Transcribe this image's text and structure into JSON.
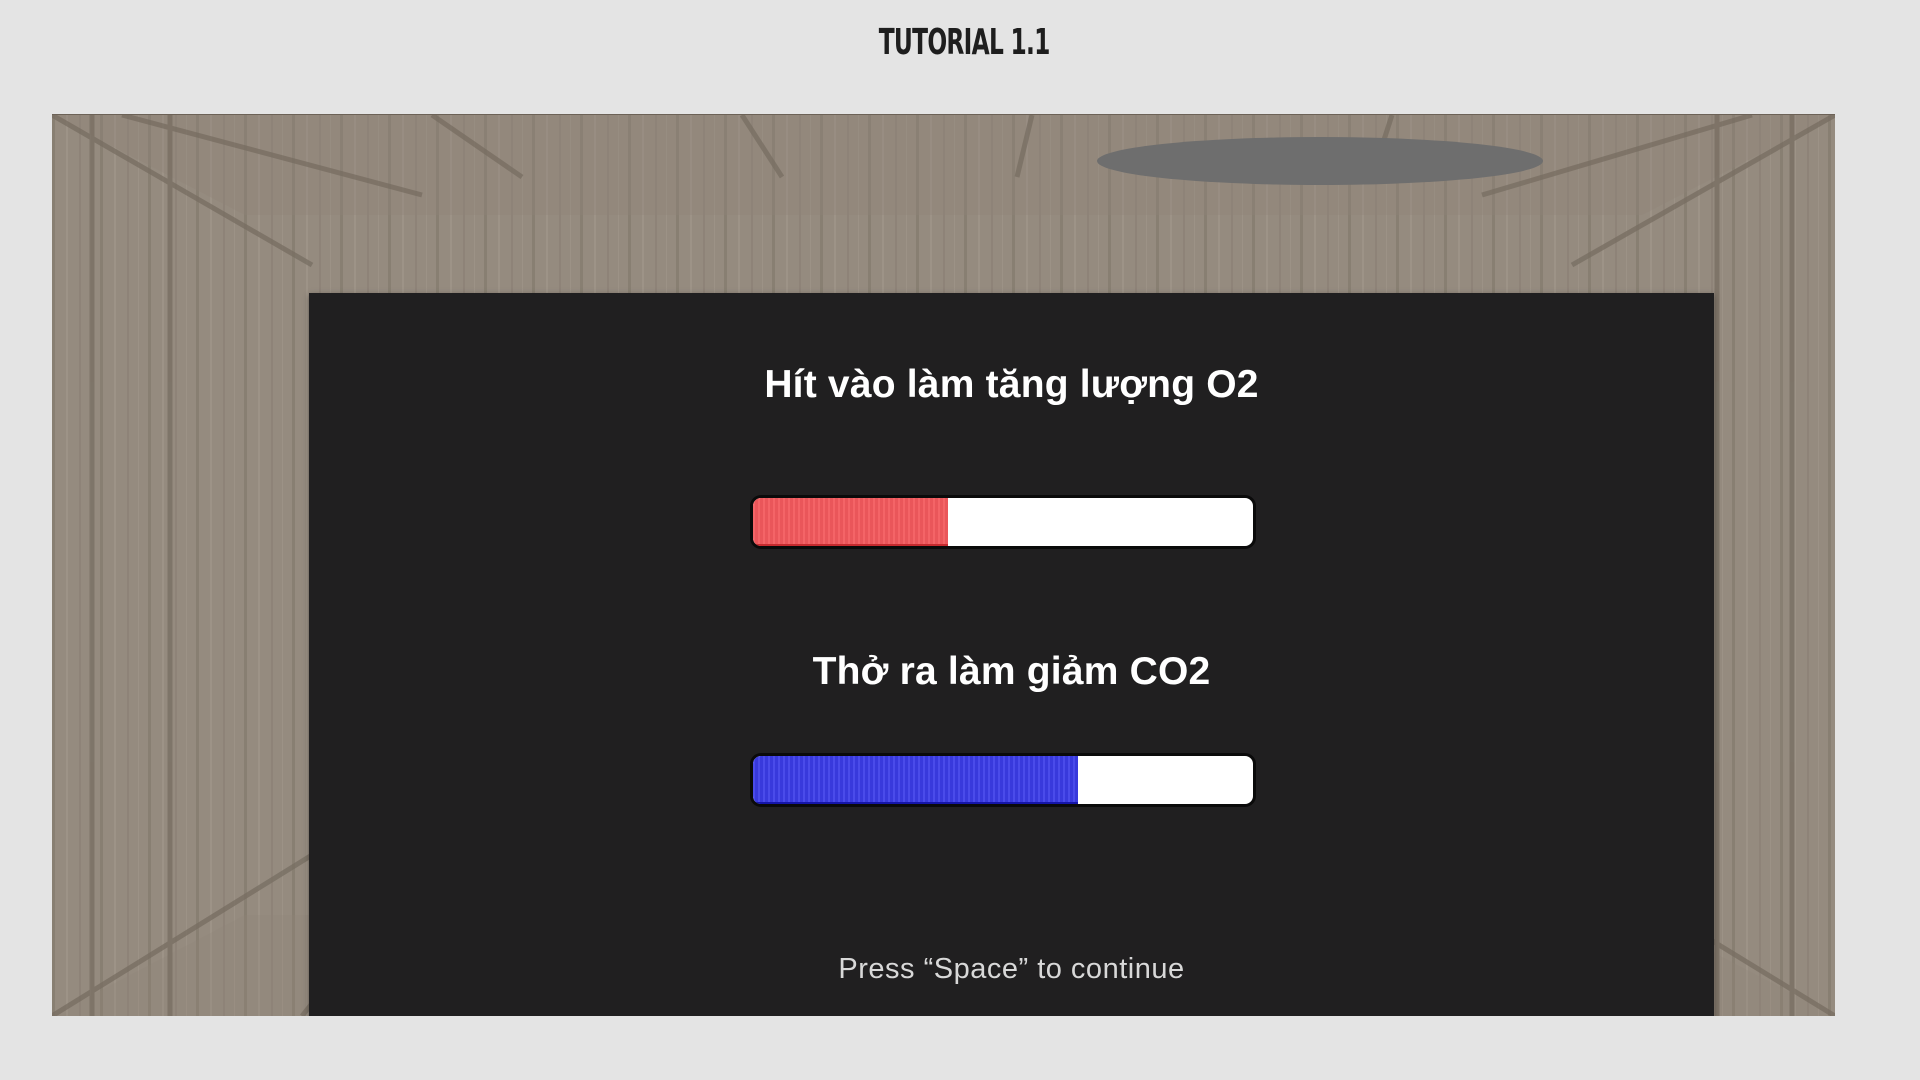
{
  "page_title": "TUTORIAL 1.1",
  "colors": {
    "page_background": "#e4e4e4",
    "floor_wood": "#958b7f",
    "panel_background": "#201f20",
    "o2_fill": "#f35a5e",
    "co2_fill": "#3b3ce8",
    "bar_empty": "#ffffff"
  },
  "dialog": {
    "o2": {
      "heading": "Hít vào làm tăng lượng O2",
      "level": 0.39
    },
    "co2": {
      "heading": "Thở ra làm giảm CO2",
      "level": 0.65
    },
    "continue_hint": "Press “Space” to continue"
  }
}
